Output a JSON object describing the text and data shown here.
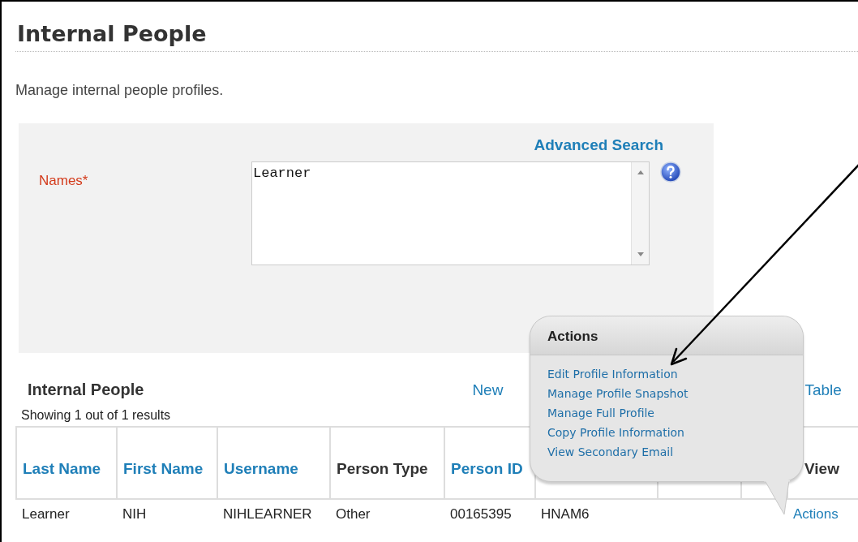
{
  "page": {
    "title": "Internal People",
    "description": "Manage internal people profiles."
  },
  "search": {
    "advanced_link": "Advanced Search",
    "field_label": "Names*",
    "value": "Learner"
  },
  "results": {
    "title": "Internal People",
    "links": [
      "New",
      "Table"
    ],
    "summary": "Showing 1 out of 1 results",
    "columns": [
      {
        "label": "Last Name",
        "link": true
      },
      {
        "label": "First Name",
        "link": true
      },
      {
        "label": "Username",
        "link": true
      },
      {
        "label": "Person Type",
        "link": false
      },
      {
        "label": "Person ID",
        "link": true
      },
      {},
      {},
      {},
      {
        "label": "View",
        "link": false
      }
    ],
    "rows": [
      [
        "Learner",
        "NIH",
        "NIHLEARNER",
        "Other",
        "00165395",
        "HNAM6",
        "",
        "",
        {
          "link": "Actions"
        }
      ]
    ]
  },
  "popup": {
    "title": "Actions",
    "items": [
      "Edit Profile Information",
      "Manage Profile Snapshot",
      "Manage Full Profile",
      "Copy Profile Information",
      "View Secondary Email"
    ]
  }
}
